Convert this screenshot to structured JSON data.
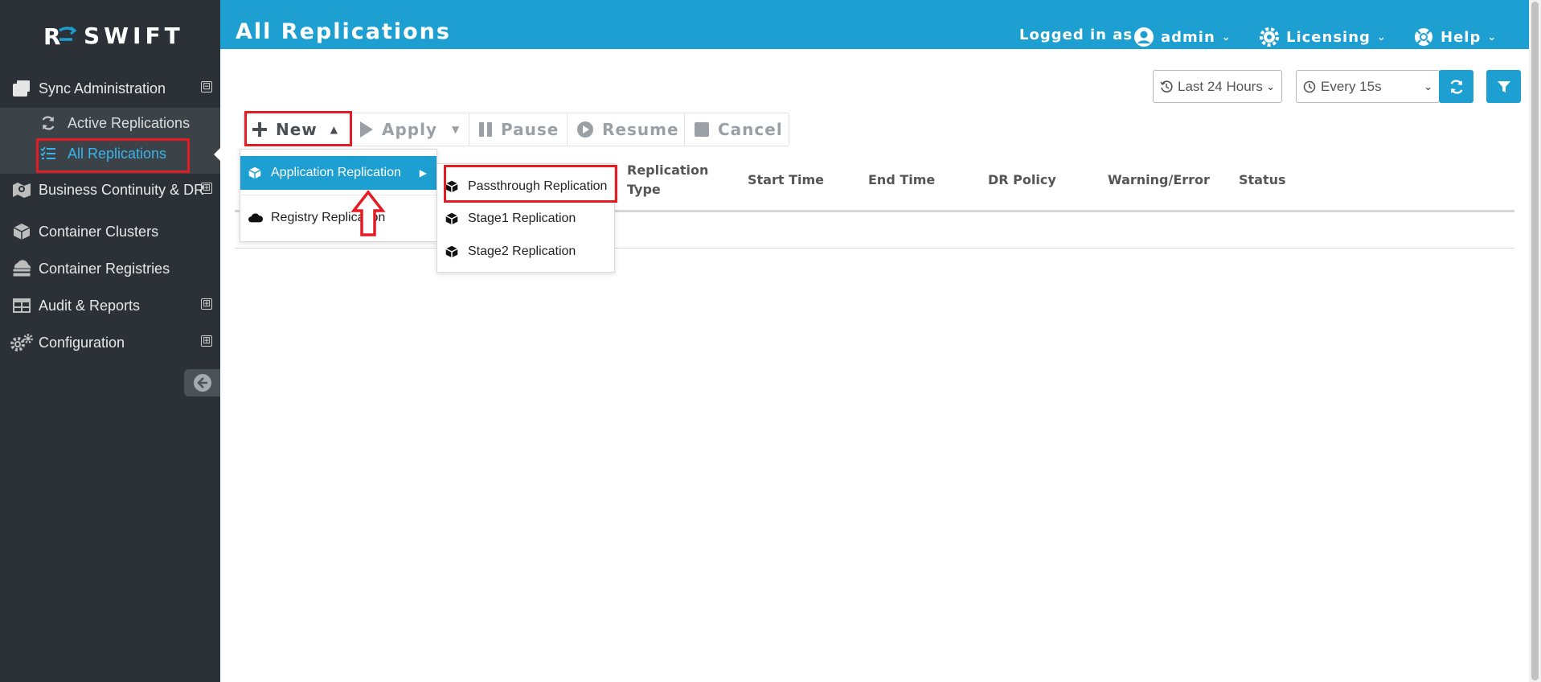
{
  "brand": {
    "name": "SWIFT",
    "mark": "R"
  },
  "sidebar": {
    "items": [
      {
        "label": "Sync Administration",
        "icon": "windows-icon",
        "expander": "⊟"
      },
      {
        "label": "Business Continuity & DR",
        "icon": "map-icon",
        "expander": "⊞"
      },
      {
        "label": "Container Clusters",
        "icon": "cube-icon",
        "expander": ""
      },
      {
        "label": "Container Registries",
        "icon": "cloud-server-icon",
        "expander": ""
      },
      {
        "label": "Audit & Reports",
        "icon": "table-icon",
        "expander": "⊞"
      },
      {
        "label": "Configuration",
        "icon": "gears-icon",
        "expander": "⊞"
      }
    ],
    "sub_items": [
      {
        "label": "Active Replications",
        "icon": "refresh-icon"
      },
      {
        "label": "All Replications",
        "icon": "list-check-icon"
      }
    ]
  },
  "header": {
    "title": "All Replications",
    "logged_in_as": "Logged in as",
    "user": "admin",
    "licensing": "Licensing",
    "help": "Help"
  },
  "filters": {
    "time_range": "Last 24 Hours",
    "refresh_interval": "Every 15s"
  },
  "toolbar": {
    "new": "New",
    "apply": "Apply",
    "pause": "Pause",
    "resume": "Resume",
    "cancel": "Cancel"
  },
  "new_menu": {
    "items": [
      "Application Replication",
      "Registry Replication"
    ]
  },
  "app_submenu": {
    "items": [
      "Passthrough Replication",
      "Stage1 Replication",
      "Stage2 Replication"
    ]
  },
  "table": {
    "columns": {
      "replication_type_line1": "Replication",
      "replication_type_line2": "Type",
      "start_time": "Start Time",
      "end_time": "End Time",
      "dr_policy": "DR Policy",
      "warning_error": "Warning/Error",
      "status": "Status"
    }
  },
  "colors": {
    "accent": "#1d9fd1",
    "sidebar": "#2b3136",
    "highlight": "#e31b23",
    "active_link": "#3ab3ea"
  }
}
